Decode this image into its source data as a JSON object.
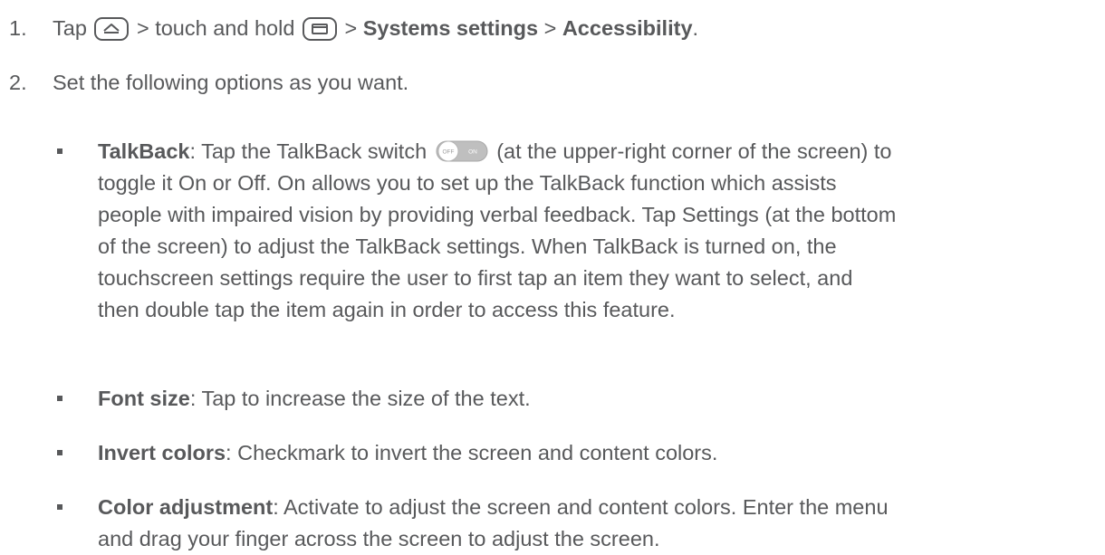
{
  "step1": {
    "num": "1.",
    "pre": "Tap",
    "sep1": "> touch and hold",
    "sep2": ">",
    "strong1": "Systems settings",
    "sep3": ">",
    "strong2": "Accessibility",
    "end": ".",
    "icons": [
      "home-key-icon",
      "recent-apps-key-icon"
    ]
  },
  "step2": {
    "num": "2.",
    "text": "Set the following options as you want."
  },
  "switch_icon": {
    "off_label": "OFF",
    "on_label": "ON"
  },
  "bullets": [
    {
      "term": "TalkBack",
      "pre": ": Tap the TalkBack switch",
      "lines_after": [
        "(at the upper-right corner of the screen) to",
        "toggle it On or Off. On allows you to set up the TalkBack function which assists",
        "people with impaired vision by providing verbal feedback. Tap Settings (at the bottom",
        "of the screen) to adjust the TalkBack settings. When TalkBack is turned on, the",
        "touchscreen settings require the user to first tap an item they want to select, and",
        "then double tap the item again in order to access this feature."
      ]
    },
    {
      "term": "Font size",
      "lines": [
        ": Tap to increase the size of the text."
      ]
    },
    {
      "term": "Invert colors",
      "lines": [
        ": Checkmark to invert the screen and content colors."
      ]
    },
    {
      "term": "Color adjustment",
      "lines": [
        ": Activate to adjust the screen and content colors. Enter the menu",
        "and drag your finger across the screen to adjust the screen."
      ]
    }
  ]
}
